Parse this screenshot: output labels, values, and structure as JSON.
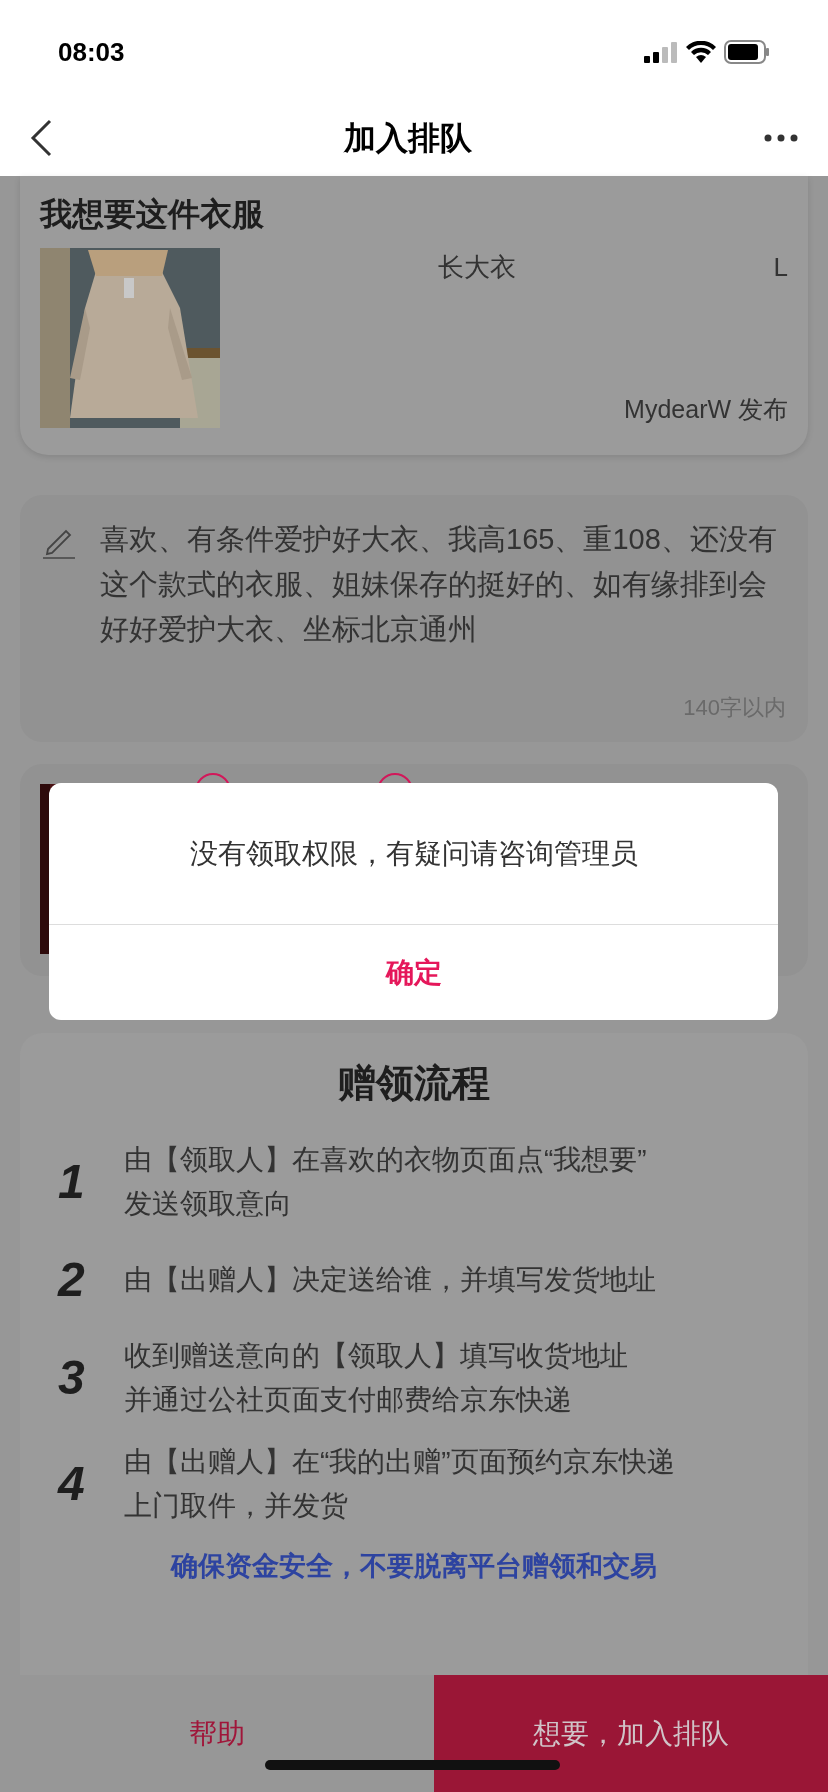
{
  "status_bar": {
    "time": "08:03"
  },
  "nav": {
    "title": "加入排队"
  },
  "item": {
    "heading": "我想要这件衣服",
    "name": "长大衣",
    "size": "L",
    "publisher": "MydearW 发布"
  },
  "note": {
    "text": "喜欢、有条件爱护好大衣、我高165、重108、还没有这个款式的衣服、姐妹保存的挺好的、如有缘排到会好好爱护大衣、坐标北京通州",
    "limit": "140字以内"
  },
  "photos": [
    {
      "kind": "picture"
    },
    {
      "kind": "covered"
    }
  ],
  "dialog": {
    "message": "没有领取权限，有疑问请咨询管理员",
    "button": "确定"
  },
  "process": {
    "title": "赠领流程",
    "steps": [
      {
        "number": "1",
        "lines": [
          "由【领取人】在喜欢的衣物页面点“我想要”",
          "发送领取意向"
        ]
      },
      {
        "number": "2",
        "lines": [
          "由【出赠人】决定送给谁，并填写发货地址"
        ]
      },
      {
        "number": "3",
        "lines": [
          "收到赠送意向的【领取人】填写收货地址",
          "并通过公社页面支付邮费给京东快递"
        ]
      },
      {
        "number": "4",
        "lines": [
          "由【出赠人】在“我的出赠”页面预约京东快递",
          "上门取件，并发货"
        ]
      }
    ],
    "warning": "确保资金安全，不要脱离平台赠领和交易"
  },
  "bottom_bar": {
    "help": "帮助",
    "join": "想要，加入排队"
  }
}
